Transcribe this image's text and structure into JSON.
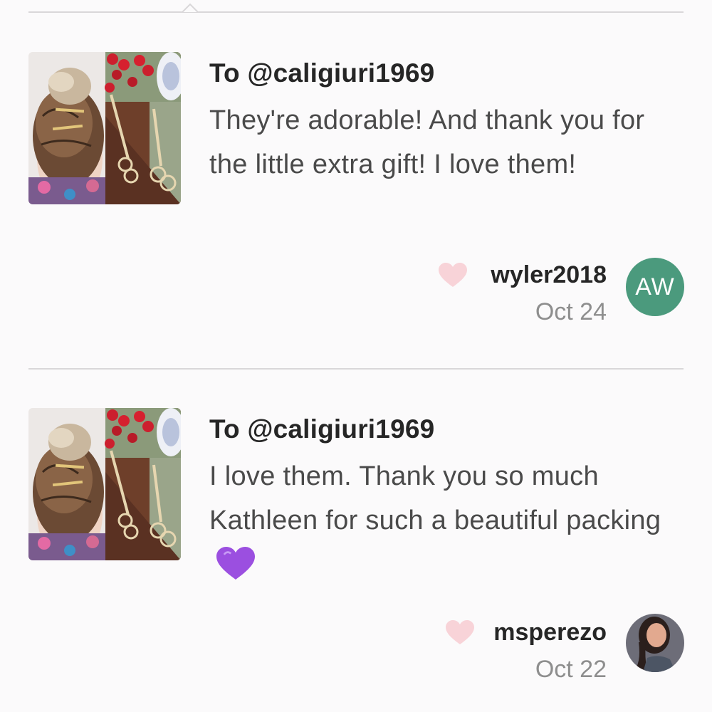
{
  "reviews": [
    {
      "recipient": "To @caligiuri1969",
      "message": "They're adorable! And thank you for the little extra gift! I love them!",
      "username": "wyler2018",
      "date": "Oct 24",
      "avatar_initials": "AW",
      "avatar_color": "#4b9a7d",
      "heart_icon": "heart-outline-icon",
      "thumbnail": "product-photo-hair-pins"
    },
    {
      "recipient": "To @caligiuri1969",
      "message": "I love them. Thank you so much Kathleen for such a beautiful packing",
      "emoji": "purple-heart-emoji",
      "username": "msperezo",
      "date": "Oct 22",
      "avatar": "profile-photo",
      "heart_icon": "heart-outline-icon",
      "thumbnail": "product-photo-hair-pins"
    }
  ],
  "colors": {
    "background": "#fbfafb",
    "heart": "#f8d3d8",
    "emoji_purple": "#9b4fe0"
  }
}
